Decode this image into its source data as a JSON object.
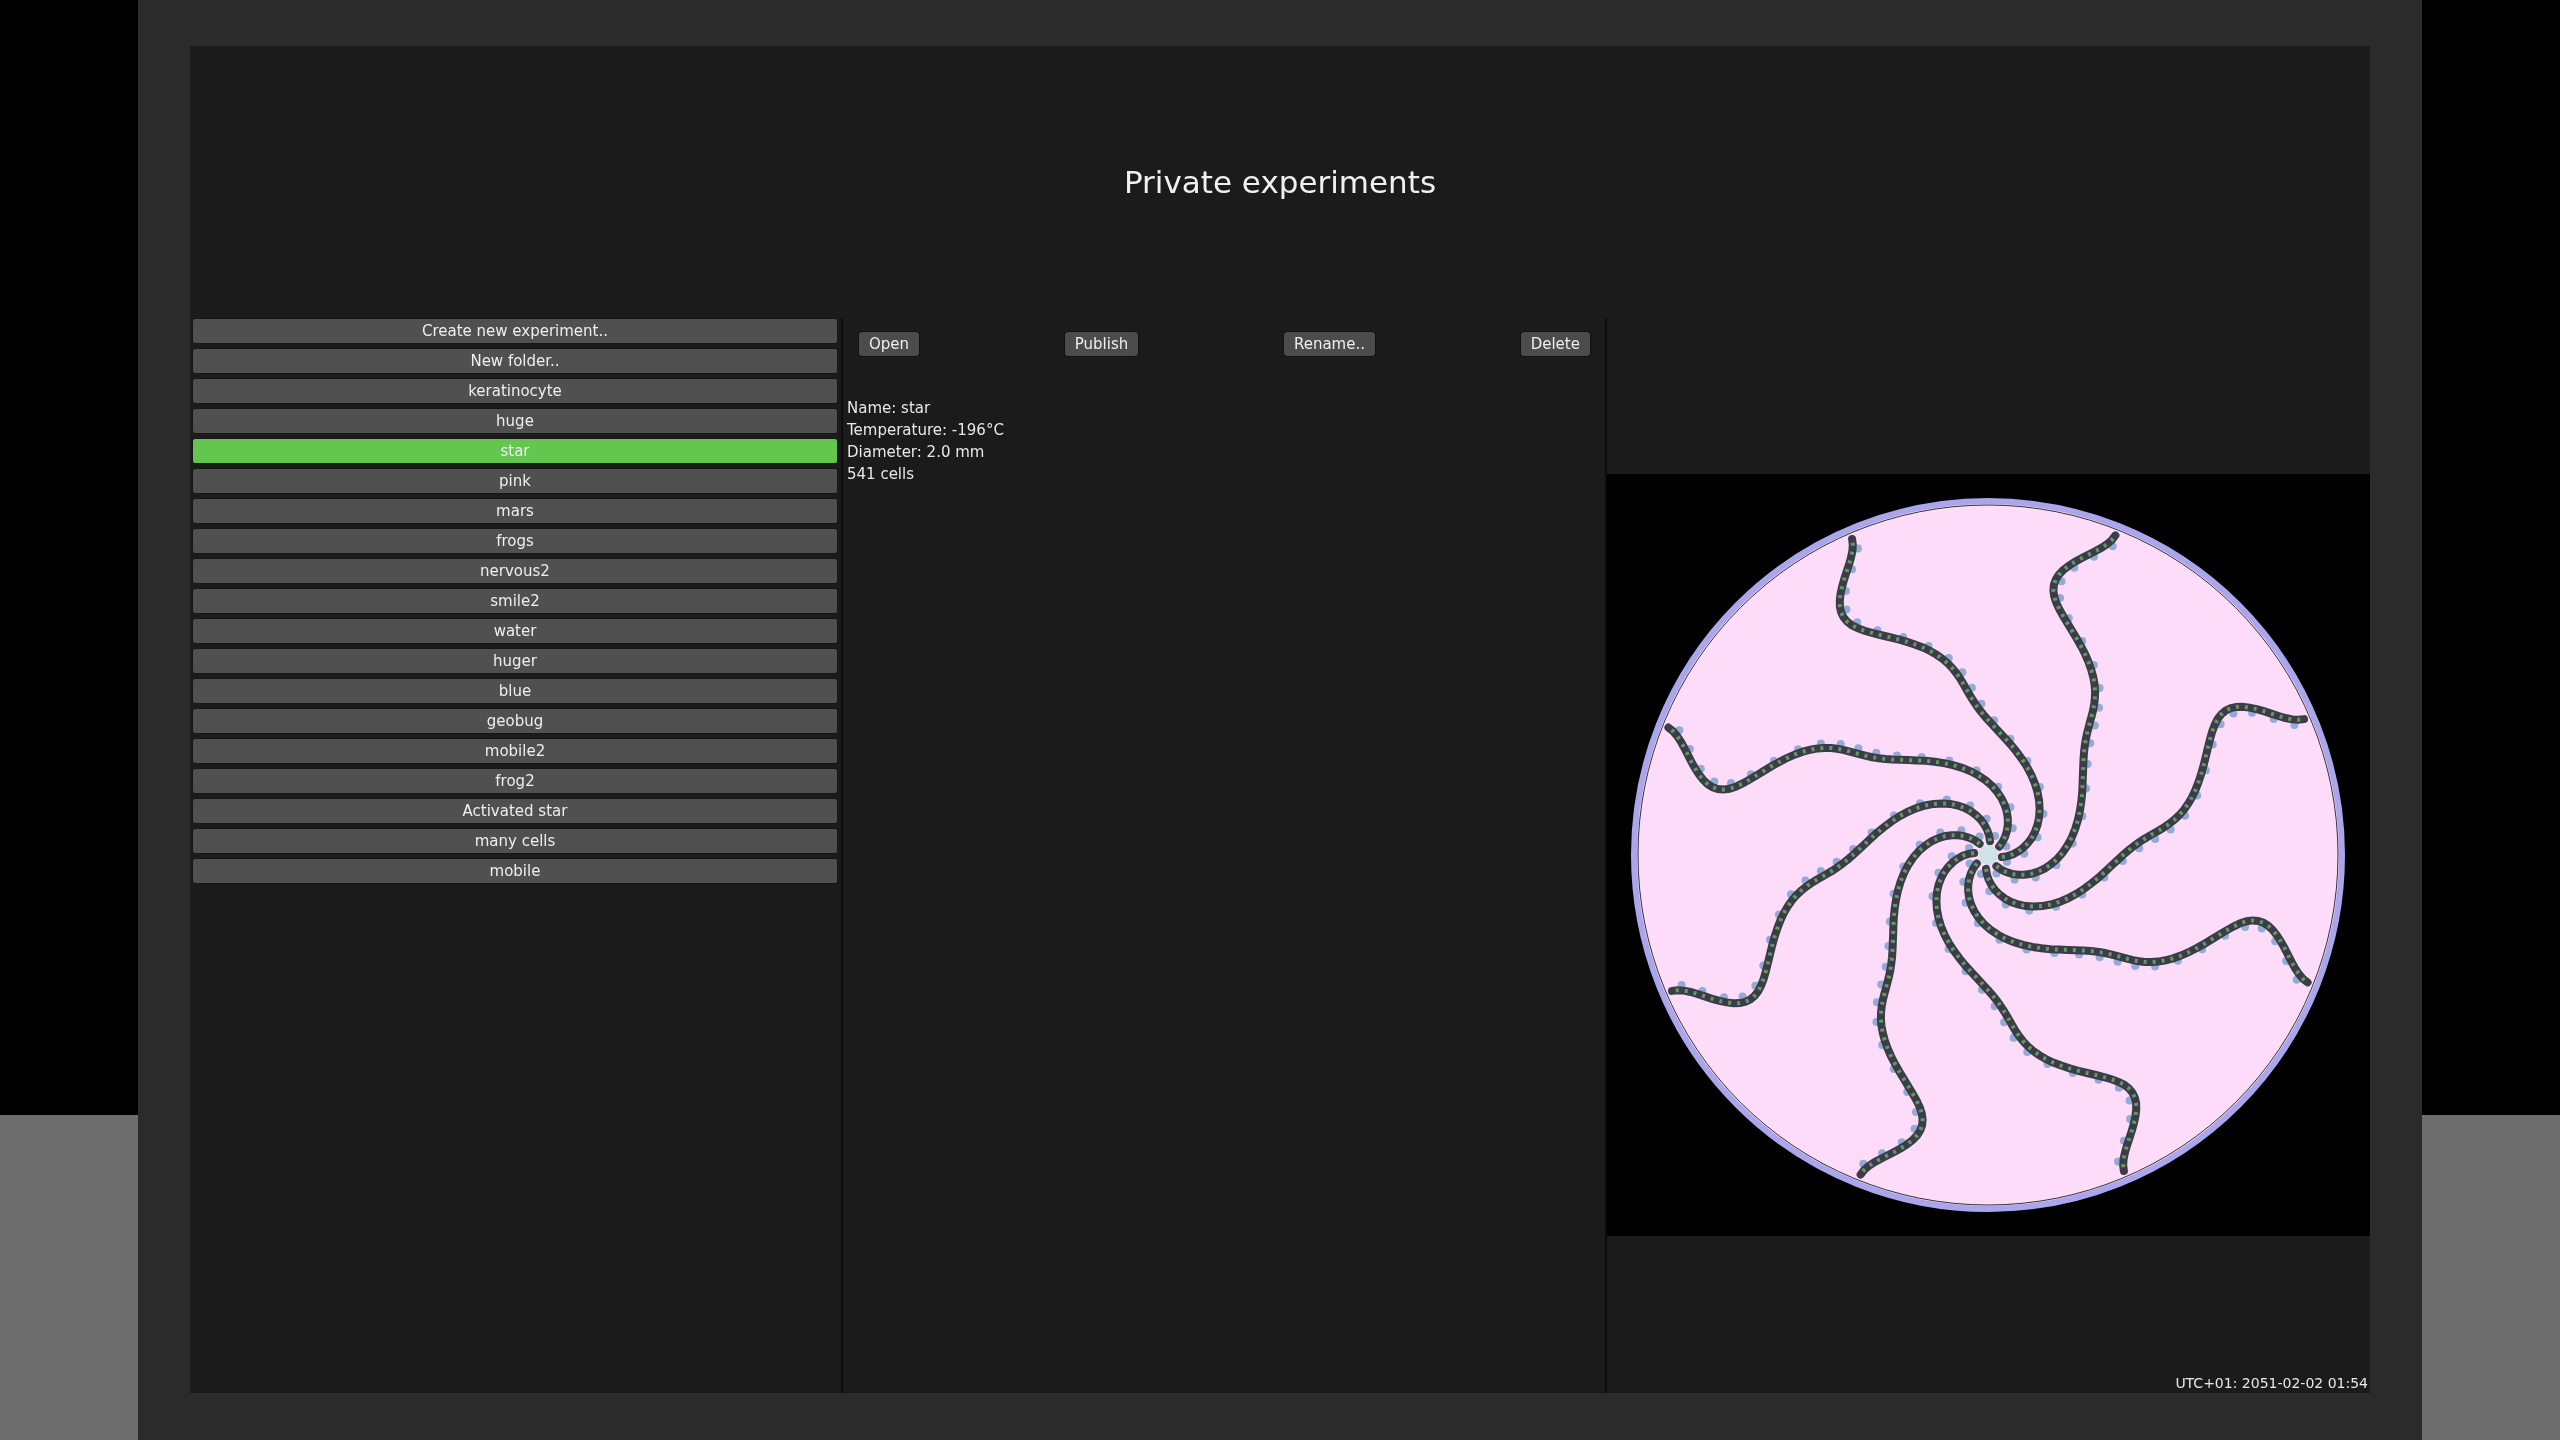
{
  "title": "Private experiments",
  "experiments": [
    {
      "label": "Create new experiment..",
      "selected": false
    },
    {
      "label": "New folder..",
      "selected": false
    },
    {
      "label": "keratinocyte",
      "selected": false
    },
    {
      "label": "huge",
      "selected": false
    },
    {
      "label": "star",
      "selected": true
    },
    {
      "label": "pink",
      "selected": false
    },
    {
      "label": "mars",
      "selected": false
    },
    {
      "label": "frogs",
      "selected": false
    },
    {
      "label": "nervous2",
      "selected": false
    },
    {
      "label": "smile2",
      "selected": false
    },
    {
      "label": "water",
      "selected": false
    },
    {
      "label": "huger",
      "selected": false
    },
    {
      "label": "blue",
      "selected": false
    },
    {
      "label": "geobug",
      "selected": false
    },
    {
      "label": "mobile2",
      "selected": false
    },
    {
      "label": "frog2",
      "selected": false
    },
    {
      "label": "Activated star",
      "selected": false
    },
    {
      "label": "many cells",
      "selected": false
    },
    {
      "label": "mobile",
      "selected": false
    }
  ],
  "actions": [
    "Open",
    "Publish",
    "Rename..",
    "Delete"
  ],
  "details": [
    "Name: star",
    "Temperature: -196°C",
    "Diameter: 2.0 mm",
    "541 cells"
  ],
  "timestamp": "UTC+01: 2051-02-02 01:54"
}
